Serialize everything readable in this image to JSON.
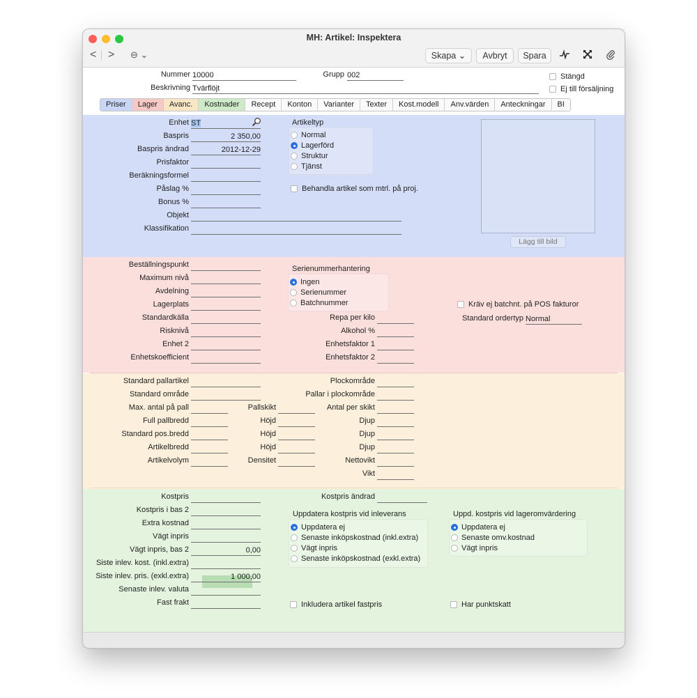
{
  "window": {
    "title": "MH: Artikel: Inspektera"
  },
  "toolbar": {
    "back": "<",
    "forward": ">",
    "more": "⊖ ⌄",
    "create": "Skapa ⌄",
    "cancel": "Avbryt",
    "save": "Spara"
  },
  "header": {
    "number_label": "Nummer",
    "number_value": "10000",
    "group_label": "Grupp",
    "group_value": "002",
    "description_label": "Beskrivning",
    "description_value": "Tvärflöjt",
    "closed_label": "Stängd",
    "not_for_sale_label": "Ej till försäljning"
  },
  "tabs": [
    "Priser",
    "Lager",
    "Avanc.",
    "Kostnader",
    "Recept",
    "Konton",
    "Varianter",
    "Texter",
    "Kost.modell",
    "Anv.värden",
    "Anteckningar",
    "BI"
  ],
  "colors": {
    "prices": "#d4ddf7",
    "stock": "#fadfdd",
    "advanced": "#fcf0dc",
    "costs": "#e3f3de",
    "selection": "#b9ddb3",
    "tab_active": "#c9d6f5",
    "tab_stock": "#f5c9c6",
    "tab_adv": "#f8e6c4",
    "tab_costs": "#cfeac8"
  },
  "prices": {
    "unit_label": "Enhet",
    "unit_value": "ST",
    "baseprice_label": "Baspris",
    "baseprice_value": "2 350,00",
    "baseprice_changed_label": "Baspris ändrad",
    "baseprice_changed_value": "2012-12-29",
    "pricefactor_label": "Prisfaktor",
    "calc_formula_label": "Beräkningsformel",
    "markup_label": "Påslag %",
    "bonus_label": "Bonus %",
    "object_label": "Objekt",
    "classification_label": "Klassifikation",
    "item_type_title": "Artikeltyp",
    "item_types": [
      "Normal",
      "Lagerförd",
      "Struktur",
      "Tjänst"
    ],
    "treat_as_material_label": "Behandla artikel som mtrl. på proj.",
    "add_image_label": "Lägg till bild"
  },
  "stock": {
    "reorder_point_label": "Beställningspunkt",
    "max_level_label": "Maximum nivå",
    "department_label": "Avdelning",
    "location_label": "Lagerplats",
    "std_source_label": "Standardkälla",
    "risk_label": "Risknivå",
    "unit2_label": "Enhet 2",
    "unit_coef_label": "Enhetskoefficient",
    "serial_title": "Serienummerhantering",
    "serial_options": [
      "Ingen",
      "Serienummer",
      "Batchnummer"
    ],
    "repa_label": "Repa per kilo",
    "alcohol_label": "Alkohol %",
    "unitfactor1_label": "Enhetsfaktor 1",
    "unitfactor2_label": "Enhetsfaktor 2",
    "no_batch_pos_label": "Kräv ej batchnt. på POS fakturor",
    "std_ordertype_label": "Standard ordertyp",
    "std_ordertype_value": "Normal"
  },
  "advanced": {
    "std_pallet_label": "Standard pallartikel",
    "std_area_label": "Standard område",
    "max_per_pallet_label": "Max. antal på pall",
    "full_pallet_width_label": "Full pallbredd",
    "std_pos_width_label": "Standard pos.bredd",
    "item_width_label": "Artikelbredd",
    "item_volume_label": "Artikelvolym",
    "pallet_layer_label": "Pallskikt",
    "height_label": "Höjd",
    "density_label": "Densitet",
    "picking_area_label": "Plockområde",
    "pallets_in_picking_label": "Pallar i plockområde",
    "count_per_layer_label": "Antal per skikt",
    "depth_label": "Djup",
    "net_weight_label": "Nettovikt",
    "weight_label": "Vikt"
  },
  "costs": {
    "cost_price_label": "Kostpris",
    "cost_price_base2_label": "Kostpris i bas 2",
    "extra_cost_label": "Extra kostnad",
    "weighted_price_label": "Vägt inpris",
    "weighted_price_base2_label": "Vägt inpris, bas 2",
    "weighted_price_base2_value": "0,00",
    "last_cost_incl_label": "Siste inlev. kost. (inkl.extra)",
    "last_price_excl_label": "Siste inlev. pris. (exkl.extra)",
    "last_price_excl_value": "1 000,00",
    "last_currency_label": "Senaste inlev. valuta",
    "fixed_freight_label": "Fast frakt",
    "cost_changed_label": "Kostpris ändrad",
    "update_on_delivery_title": "Uppdatera kostpris vid inleverans",
    "update_on_delivery_options": [
      "Uppdatera ej",
      "Senaste inköpskostnad (inkl.extra)",
      "Vägt inpris",
      "Senaste inköpskostnad (exkl.extra)"
    ],
    "update_on_revaluation_title": "Uppd. kostpris vid lageromvärdering",
    "update_on_revaluation_options": [
      "Uppdatera ej",
      "Senaste omv.kostnad",
      "Vägt inpris"
    ],
    "include_fixed_price_label": "Inkludera artikel fastpris",
    "has_excise_label": "Har punktskatt"
  }
}
